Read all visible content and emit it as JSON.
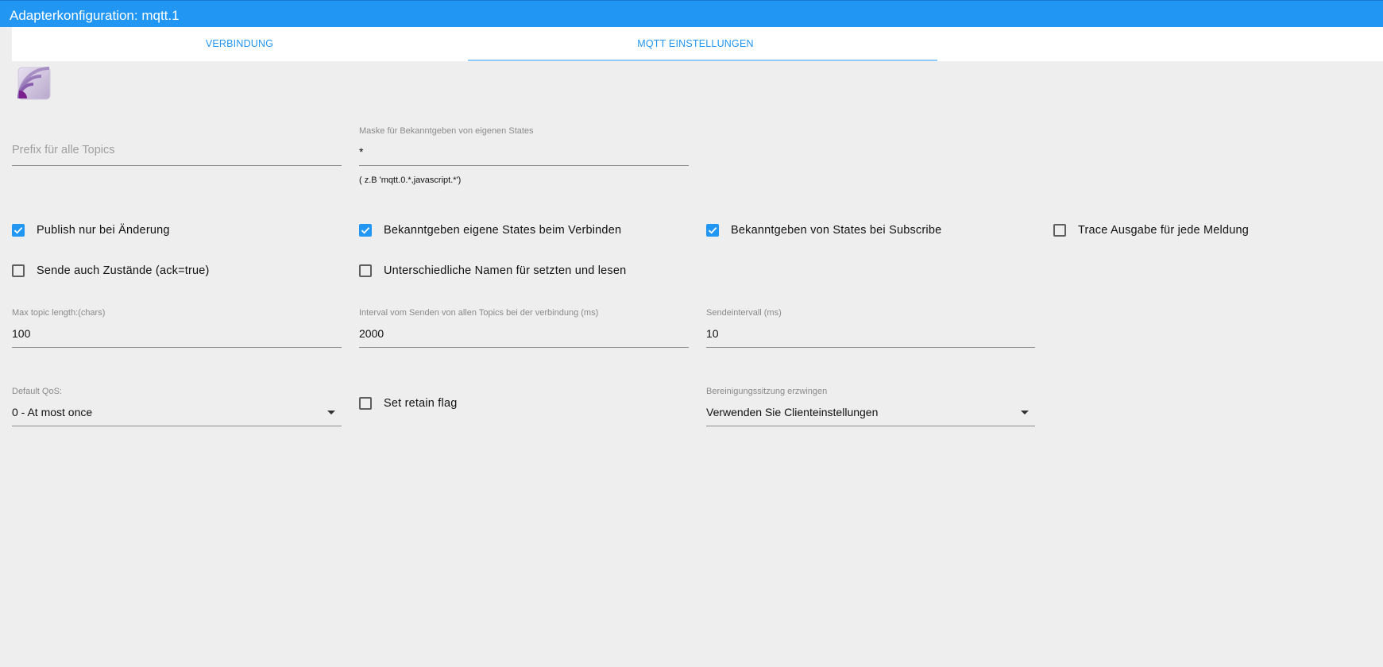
{
  "window": {
    "title": "Adapterkonfiguration: mqtt.1"
  },
  "tabs": [
    {
      "label": "VERBINDUNG",
      "active": false
    },
    {
      "label": "MQTT EINSTELLUNGEN",
      "active": true
    }
  ],
  "logo": {
    "icon": "mqtt-adapter-logo-icon"
  },
  "fields": {
    "prefix": {
      "placeholder": "Prefix für alle Topics",
      "value": ""
    },
    "mask": {
      "label": "Maske für Bekanntgeben von eigenen States",
      "value": "*",
      "helper": "( z.B 'mqtt.0.*,javascript.*')"
    },
    "max_topic_length": {
      "label": "Max topic length:(chars)",
      "value": "100"
    },
    "interval_send_all": {
      "label": "Interval vom Senden von allen Topics bei der verbindung (ms)",
      "value": "2000"
    },
    "send_interval": {
      "label": "Sendeintervall (ms)",
      "value": "10"
    },
    "default_qos": {
      "label": "Default QoS:",
      "value": "0 - At most once"
    },
    "clean_session": {
      "label": "Bereinigungssitzung erzwingen",
      "value": "Verwenden Sie Clienteinstellungen"
    }
  },
  "checkboxes": {
    "publish_on_change": {
      "label": "Publish nur bei Änderung",
      "checked": true
    },
    "publish_own_states_on_connect": {
      "label": "Bekanntgeben eigene States beim Verbinden",
      "checked": true
    },
    "publish_states_on_subscribe": {
      "label": "Bekanntgeben von States bei Subscribe",
      "checked": true
    },
    "trace_output": {
      "label": "Trace Ausgabe für jede Meldung",
      "checked": false
    },
    "send_ack_true": {
      "label": "Sende auch Zustände (ack=true)",
      "checked": false
    },
    "different_names": {
      "label": "Unterschiedliche Namen für setzten und lesen",
      "checked": false
    },
    "retain_flag": {
      "label": "Set retain flag",
      "checked": false
    }
  },
  "colors": {
    "accent": "#2196f3",
    "background": "#eeeeee"
  }
}
